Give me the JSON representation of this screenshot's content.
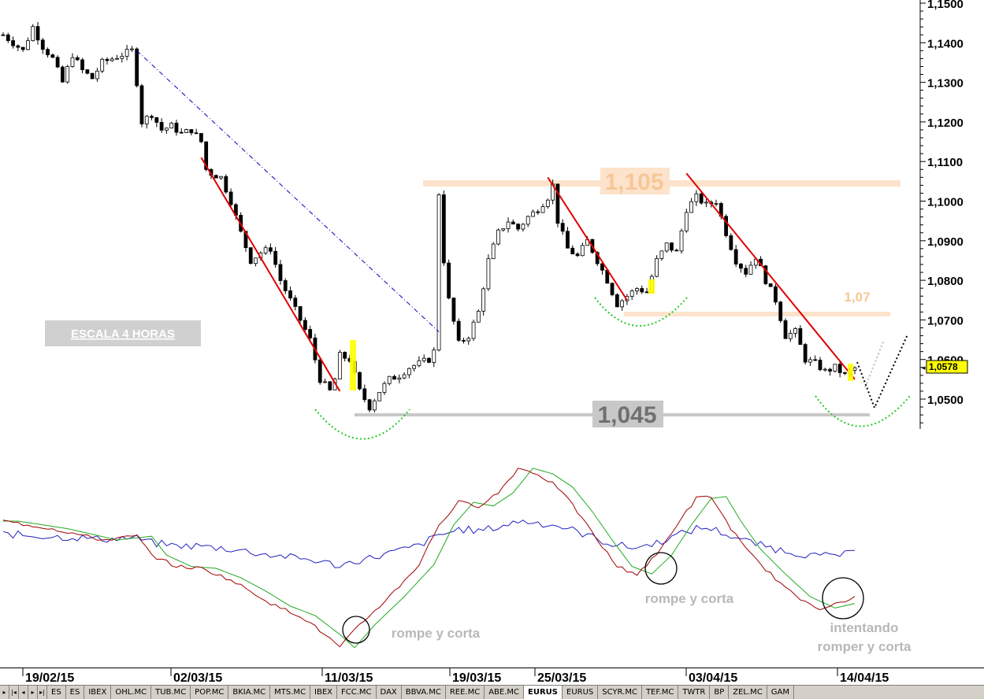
{
  "chart_data": [
    {
      "type": "candlestick",
      "title": "",
      "ylim": [
        1.045,
        1.15
      ],
      "y_ticks": [
        "1,1500",
        "1,1400",
        "1,1300",
        "1,1200",
        "1,1100",
        "1,1000",
        "1,0900",
        "1,0800",
        "1,0700",
        "1,0600",
        "1,0500"
      ],
      "x_ticks": [
        "19/02/15",
        "02/03/15",
        "11/03/15",
        "19/03/15",
        "25/03/15",
        "03/04/15",
        "14/04/15"
      ],
      "last_price": "1,0578",
      "grid": false,
      "levels": [
        {
          "label": "1,105",
          "value": 1.104,
          "color": "#fde3cc"
        },
        {
          "label": "1,07",
          "value": 1.0715,
          "color": "#fde3cc"
        },
        {
          "label": "1,045",
          "value": 1.046,
          "color": "#c8c8c8"
        }
      ],
      "price_path": [
        [
          0,
          1.142
        ],
        [
          4,
          1.138
        ],
        [
          6,
          1.144
        ],
        [
          8,
          1.139
        ],
        [
          10,
          1.136
        ],
        [
          12,
          1.13
        ],
        [
          14,
          1.137
        ],
        [
          16,
          1.133
        ],
        [
          18,
          1.131
        ],
        [
          20,
          1.135
        ],
        [
          22,
          1.136
        ],
        [
          24,
          1.137
        ],
        [
          26,
          1.138
        ],
        [
          27,
          1.13
        ],
        [
          28,
          1.12
        ],
        [
          30,
          1.122
        ],
        [
          32,
          1.118
        ],
        [
          34,
          1.119
        ],
        [
          36,
          1.117
        ],
        [
          38,
          1.118
        ],
        [
          40,
          1.115
        ],
        [
          41,
          1.108
        ],
        [
          42,
          1.107
        ],
        [
          44,
          1.106
        ],
        [
          46,
          1.1
        ],
        [
          48,
          1.092
        ],
        [
          50,
          1.085
        ],
        [
          52,
          1.087
        ],
        [
          54,
          1.088
        ],
        [
          56,
          1.08
        ],
        [
          58,
          1.075
        ],
        [
          60,
          1.07
        ],
        [
          62,
          1.065
        ],
        [
          64,
          1.055
        ],
        [
          66,
          1.052
        ],
        [
          67,
          1.055
        ],
        [
          68,
          1.061
        ],
        [
          70,
          1.06
        ],
        [
          72,
          1.052
        ],
        [
          74,
          1.048
        ],
        [
          76,
          1.052
        ],
        [
          78,
          1.055
        ],
        [
          80,
          1.056
        ],
        [
          82,
          1.058
        ],
        [
          84,
          1.059
        ],
        [
          86,
          1.06
        ],
        [
          87,
          1.062
        ],
        [
          88,
          1.102
        ],
        [
          89,
          1.085
        ],
        [
          90,
          1.075
        ],
        [
          92,
          1.064
        ],
        [
          94,
          1.066
        ],
        [
          96,
          1.072
        ],
        [
          98,
          1.085
        ],
        [
          100,
          1.092
        ],
        [
          102,
          1.095
        ],
        [
          104,
          1.093
        ],
        [
          106,
          1.096
        ],
        [
          108,
          1.098
        ],
        [
          110,
          1.101
        ],
        [
          111,
          1.104
        ],
        [
          112,
          1.095
        ],
        [
          114,
          1.088
        ],
        [
          116,
          1.086
        ],
        [
          118,
          1.09
        ],
        [
          120,
          1.085
        ],
        [
          122,
          1.08
        ],
        [
          124,
          1.074
        ],
        [
          126,
          1.076
        ],
        [
          128,
          1.078
        ],
        [
          130,
          1.077
        ],
        [
          132,
          1.085
        ],
        [
          134,
          1.089
        ],
        [
          136,
          1.087
        ],
        [
          138,
          1.098
        ],
        [
          140,
          1.101
        ],
        [
          142,
          1.099
        ],
        [
          144,
          1.1
        ],
        [
          146,
          1.092
        ],
        [
          148,
          1.085
        ],
        [
          150,
          1.082
        ],
        [
          152,
          1.086
        ],
        [
          154,
          1.08
        ],
        [
          156,
          1.075
        ],
        [
          158,
          1.066
        ],
        [
          160,
          1.067
        ],
        [
          162,
          1.06
        ],
        [
          164,
          1.059
        ],
        [
          166,
          1.057
        ],
        [
          168,
          1.058
        ],
        [
          170,
          1.056
        ],
        [
          172,
          1.0578
        ]
      ],
      "trendlines": [
        {
          "color": "#e00000",
          "from": [
            40,
            1.111
          ],
          "to": [
            68,
            1.052
          ]
        },
        {
          "color": "#e00000",
          "from": [
            110,
            1.106
          ],
          "to": [
            126,
            1.075
          ]
        },
        {
          "color": "#e00000",
          "from": [
            138,
            1.107
          ],
          "to": [
            172,
            1.055
          ]
        },
        {
          "color": "#0000c0",
          "style": "dashdot",
          "from": [
            27,
            1.138
          ],
          "to": [
            88,
            1.067
          ]
        }
      ],
      "annotations": [
        {
          "text": "ESCALA 4 HORAS"
        }
      ]
    },
    {
      "type": "line",
      "title": "",
      "annotations": [
        "rompe y corta",
        "rompe y corta",
        "intentando",
        "romper y corta"
      ]
    }
  ],
  "tabs": [
    "ES",
    "ES",
    "IBEX",
    "OHL.MC",
    "TUB.MC",
    "POP.MC",
    "BKIA.MC",
    "MTS.MC",
    "IBEX",
    "FCC.MC",
    "DAX",
    "BBVA.MC",
    "REE.MC",
    "ABE.MC",
    "EURUS",
    "EURUS",
    "SCYR.MC",
    "TEF.MC",
    "TWTR",
    "BP",
    "ZEL.MC",
    "GAM"
  ],
  "active_tab_index": 14,
  "nav_icons": [
    "scroll-left-icon",
    "first-icon",
    "prev-icon",
    "next-icon",
    "last-icon"
  ]
}
